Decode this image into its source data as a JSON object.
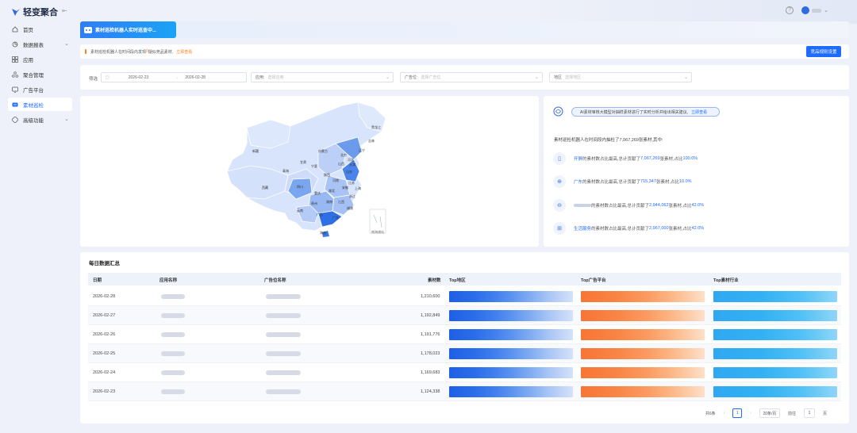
{
  "app": {
    "name": "轻变聚合"
  },
  "sidebar": {
    "items": [
      {
        "label": "首页",
        "icon": "home-icon",
        "active": false,
        "has_children": false
      },
      {
        "label": "数据报表",
        "icon": "chart-icon",
        "active": false,
        "has_children": true
      },
      {
        "label": "应用",
        "icon": "apps-icon",
        "active": false,
        "has_children": false
      },
      {
        "label": "聚合管理",
        "icon": "cluster-icon",
        "active": false,
        "has_children": false
      },
      {
        "label": "广告平台",
        "icon": "monitor-icon",
        "active": false,
        "has_children": false
      },
      {
        "label": "素材巡检",
        "icon": "inspect-icon",
        "active": true,
        "has_children": false
      },
      {
        "label": "高级功能",
        "icon": "advanced-icon",
        "active": false,
        "has_children": true
      }
    ]
  },
  "banner": {
    "tag": "素材巡检机器人实时巡查中..."
  },
  "notice": {
    "prefix": "素材巡检机器人在时间段内发现",
    "count": "0",
    "suffix": "疑似竞品素材,",
    "link": "立即查看",
    "button": "竞品规则设置"
  },
  "filters": {
    "filter_label": "筛选",
    "date_start": "2026-02-23",
    "date_end": "2026-02-28",
    "app_label": "应用:",
    "app_placeholder": "选择应用",
    "ad_slot_label": "广告位:",
    "ad_slot_placeholder": "选择广告位",
    "region_label": "地区",
    "region_placeholder": "选择地区"
  },
  "map": {
    "provinces": [
      "黑龙江",
      "吉林",
      "辽宁",
      "内蒙古",
      "新疆",
      "西藏",
      "青海",
      "甘肃",
      "宁夏",
      "陕西",
      "山西",
      "河北",
      "北京",
      "天津",
      "山东",
      "河南",
      "江苏",
      "安徽",
      "上海",
      "浙江",
      "湖北",
      "四川",
      "重庆",
      "贵州",
      "云南",
      "湖南",
      "江西",
      "福建",
      "广西",
      "广东",
      "海南"
    ],
    "inset_label": "南海诸岛"
  },
  "ai": {
    "bubble_text": "AI素材审核大模型对抽样素材进行了实时分析并给出相关建议,",
    "bubble_link": "立即查看",
    "summary": "素材巡检机器人在时间段内抽检了7,067,269张素材,其中:",
    "rows": [
      {
        "icon": "document-icon",
        "subject": "开屏",
        "mid": "的素材数占比最高,总计贡献了",
        "count": "7,067,269",
        "tail": "张素材,占比",
        "pct": "100.0%"
      },
      {
        "icon": "globe-icon",
        "subject": "广东",
        "mid": "的素材数占比最高,总计贡献了",
        "count": "715,347",
        "tail": "张素材,占比",
        "pct": "10.0%"
      },
      {
        "icon": "platform-icon",
        "subject": "",
        "mid": "的素材数占比最高,总计贡献了",
        "count": "2,944,062",
        "tail": "张素材,占比",
        "pct": "42.0%"
      },
      {
        "icon": "category-icon",
        "subject": "生活服务",
        "mid": "的素材数占比最高,总计贡献了",
        "count": "2,967,000",
        "tail": "张素材,占比",
        "pct": "42.0%"
      }
    ]
  },
  "table": {
    "title": "每日数据汇总",
    "headers": [
      "日期",
      "应用名称",
      "广告位名称",
      "素材数",
      "Top地区",
      "Top广告平台",
      "Top素材行业"
    ],
    "rows": [
      {
        "date": "2026-02-28",
        "count": "1,210,600"
      },
      {
        "date": "2026-02-27",
        "count": "1,192,849"
      },
      {
        "date": "2026-02-26",
        "count": "1,191,776"
      },
      {
        "date": "2026-02-25",
        "count": "1,178,023"
      },
      {
        "date": "2026-02-24",
        "count": "1,169,683"
      },
      {
        "date": "2026-02-23",
        "count": "1,124,338"
      }
    ],
    "pager": {
      "total": "共6条",
      "page": "1",
      "page_size": "20条/页",
      "goto": "前往",
      "goto_value": "1",
      "unit": "页"
    }
  },
  "colors": {
    "primary": "#1e6bff",
    "warning": "#ff7d1a",
    "bar_blue": "#1f5fe6",
    "bar_orange": "#f77535",
    "bar_cyan": "#2fa8f1"
  }
}
